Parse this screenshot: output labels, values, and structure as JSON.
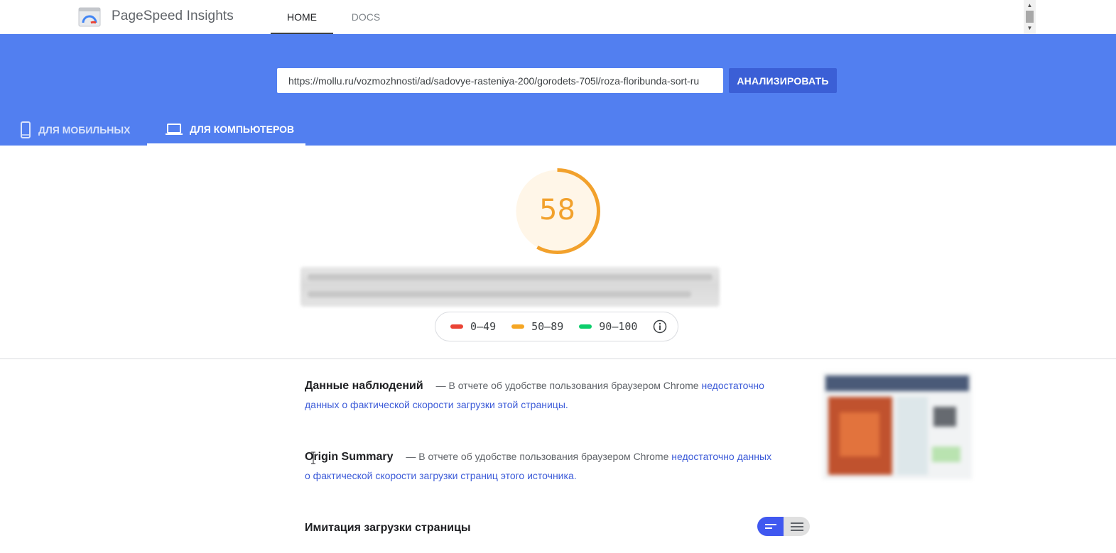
{
  "header": {
    "app_title": "PageSpeed Insights",
    "nav": [
      {
        "label": "HOME",
        "active": true
      },
      {
        "label": "DOCS",
        "active": false
      }
    ],
    "logo_icon": "pagespeed-gauge-icon"
  },
  "analyze": {
    "url_value": "https://mollu.ru/vozmozhnosti/ad/sadovye-rasteniya-200/gorodets-705l/roza-floribunda-sort-ru",
    "button_label": "АНАЛИЗИРОВАТЬ"
  },
  "device_tabs": [
    {
      "label": "ДЛЯ МОБИЛЬНЫХ",
      "icon": "smartphone-icon",
      "active": false
    },
    {
      "label": "ДЛЯ КОМПЬЮТЕРОВ",
      "icon": "laptop-icon",
      "active": true
    }
  ],
  "score": {
    "value": "58",
    "fraction": 0.58,
    "color": "#f2a12c",
    "bg_color": "#fff6e8"
  },
  "legend": [
    {
      "label": "0–49",
      "color": "#ea4335"
    },
    {
      "label": "50–89",
      "color": "#f5a623"
    },
    {
      "label": "90–100",
      "color": "#0cce6b"
    }
  ],
  "sections": {
    "field_data": {
      "title": "Данные наблюдений",
      "text": "— В отчете об удобстве пользования браузером Chrome",
      "link": "недостаточно данных о фактической скорости загрузки этой страницы."
    },
    "origin_summary": {
      "title": "Origin Summary",
      "text": "— В отчете об удобстве пользования браузером Chrome",
      "link": "недостаточно данных о фактической скорости загрузки страниц этого источника."
    },
    "lab_data": {
      "title": "Имитация загрузки страницы"
    }
  },
  "colors": {
    "hero": "#527ff0",
    "button": "#3b5fd6",
    "link": "#3c5bd8",
    "toggle_active": "#4058f0"
  }
}
